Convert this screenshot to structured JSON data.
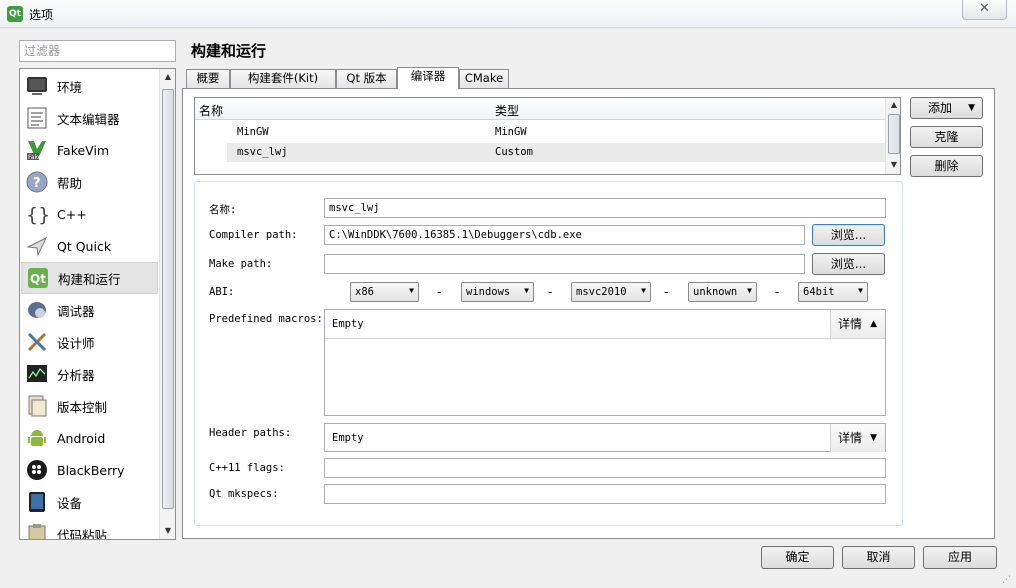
{
  "window": {
    "title": "选项",
    "app_icon": "Qt",
    "close_glyph": "✕"
  },
  "filter": {
    "placeholder": "过滤器"
  },
  "nav": {
    "items": [
      {
        "label": "环境",
        "icon": "monitor-icon"
      },
      {
        "label": "文本编辑器",
        "icon": "text-editor-icon"
      },
      {
        "label": "FakeVim",
        "icon": "fakevim-icon"
      },
      {
        "label": "帮助",
        "icon": "help-icon"
      },
      {
        "label": "C++",
        "icon": "cpp-braces-icon"
      },
      {
        "label": "Qt Quick",
        "icon": "qt-quick-icon"
      },
      {
        "label": "构建和运行",
        "icon": "build-run-icon"
      },
      {
        "label": "调试器",
        "icon": "debugger-icon"
      },
      {
        "label": "设计师",
        "icon": "designer-icon"
      },
      {
        "label": "分析器",
        "icon": "analyzer-icon"
      },
      {
        "label": "版本控制",
        "icon": "version-control-icon"
      },
      {
        "label": "Android",
        "icon": "android-icon"
      },
      {
        "label": "BlackBerry",
        "icon": "blackberry-icon"
      },
      {
        "label": "设备",
        "icon": "device-icon"
      },
      {
        "label": "代码粘贴",
        "icon": "code-paste-icon"
      }
    ],
    "selected": "构建和运行"
  },
  "page_title": "构建和运行",
  "tabs": [
    {
      "label": "概要"
    },
    {
      "label": "构建套件(Kit)"
    },
    {
      "label": "Qt 版本"
    },
    {
      "label": "编译器"
    },
    {
      "label": "CMake"
    }
  ],
  "active_tab": "编译器",
  "compiler_table": {
    "headers": {
      "name": "名称",
      "type": "类型"
    },
    "rows": [
      {
        "name": "MinGW",
        "type": "MinGW"
      },
      {
        "name": "msvc_lwj",
        "type": "Custom"
      }
    ]
  },
  "side_buttons": {
    "add": "添加",
    "clone": "克隆",
    "remove": "删除"
  },
  "form": {
    "name_label": "名称:",
    "name_value": "msvc_lwj",
    "compiler_path_label": "Compiler path:",
    "compiler_path_value": "C:\\WinDDK\\7600.16385.1\\Debuggers\\cdb.exe",
    "browse": "浏览...",
    "make_path_label": "Make path:",
    "make_path_value": "",
    "abi_label": "ABI:",
    "abi": [
      "x86",
      "windows",
      "msvc2010",
      "unknown",
      "64bit"
    ],
    "abi_sep": "-",
    "macros_label": "Predefined macros:",
    "macros_value": "Empty",
    "details": "详情",
    "header_paths_label": "Header paths:",
    "header_paths_value": "Empty",
    "cxx11_label": "C++11 flags:",
    "cxx11_value": "",
    "mkspecs_label": "Qt mkspecs:",
    "mkspecs_value": ""
  },
  "footer": {
    "ok": "确定",
    "cancel": "取消",
    "apply": "应用"
  }
}
